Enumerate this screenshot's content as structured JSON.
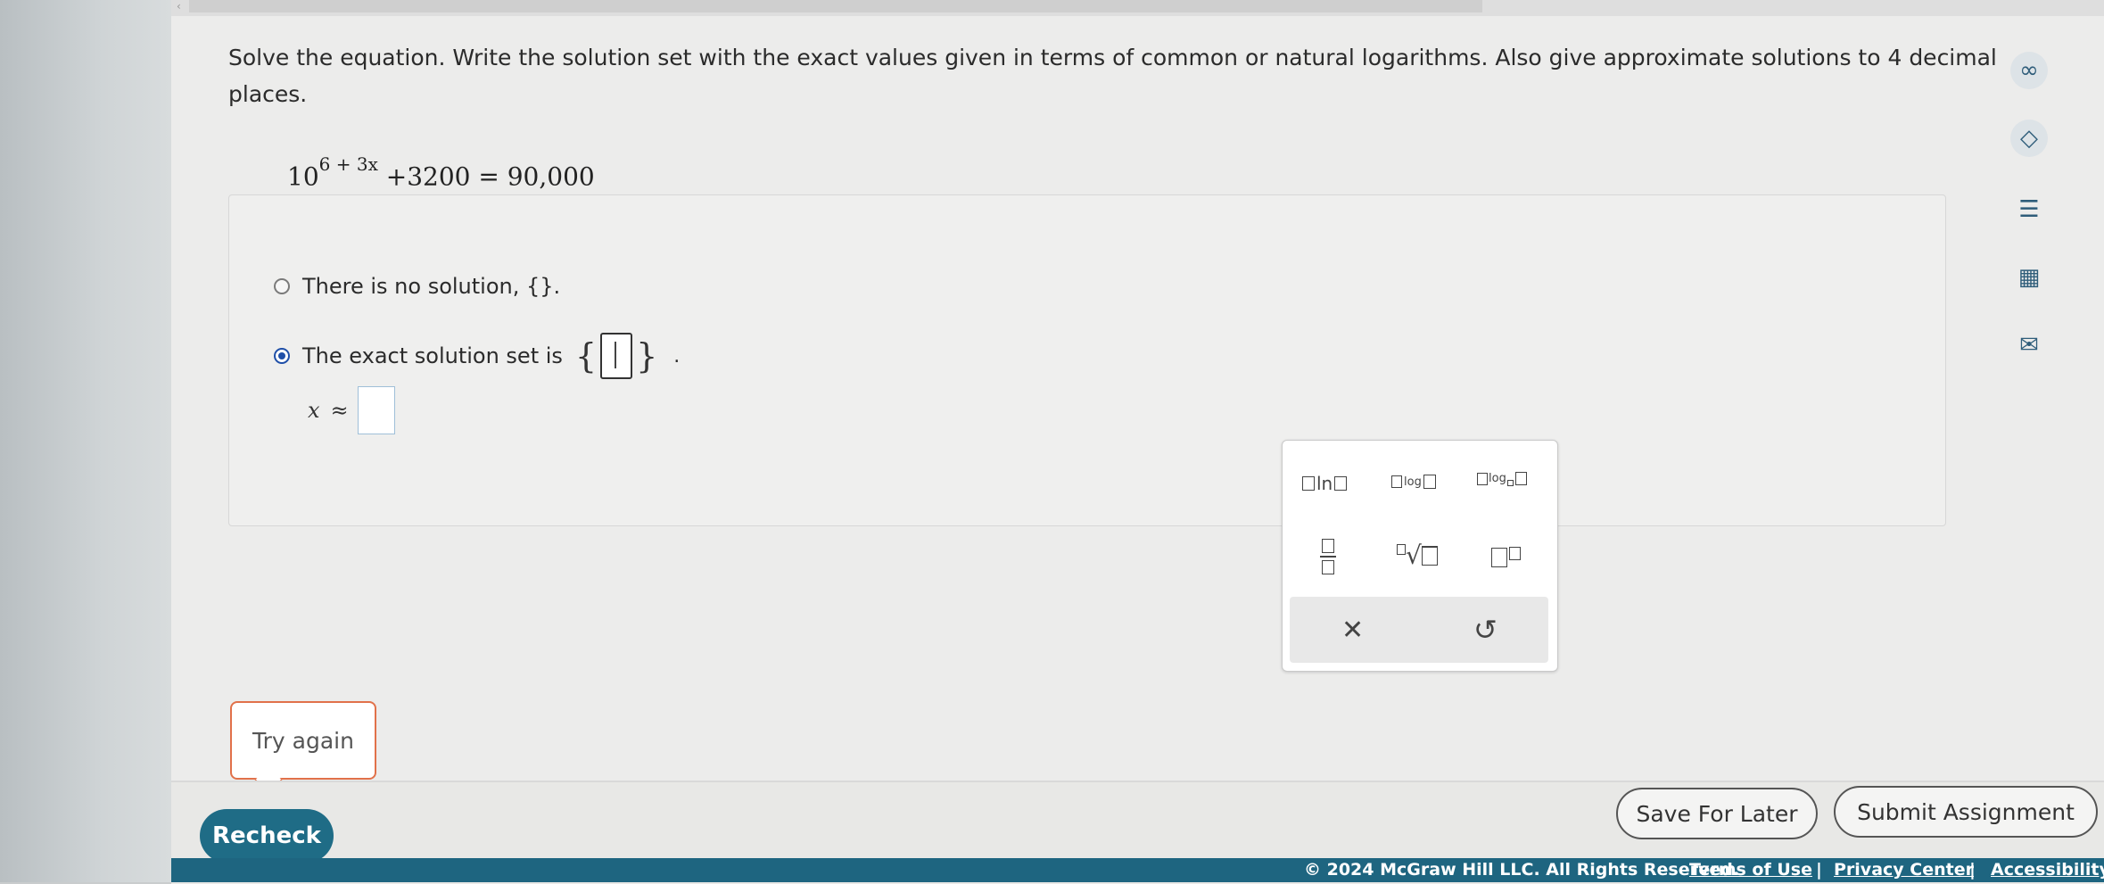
{
  "question": {
    "prompt": "Solve the equation. Write the solution set with the exact values given in terms of common or natural logarithms. Also give approximate solutions to 4 decimal places.",
    "equation_base": "10",
    "equation_exponent": "6 + 3x",
    "equation_rest": "+3200 = 90,000"
  },
  "options": {
    "no_solution": "There is no solution, {}.",
    "exact_set": "The exact solution set is",
    "selected": "exact_set"
  },
  "approx": {
    "var": "x",
    "symbol": "≈"
  },
  "palette": {
    "ln": "ln",
    "log": "log",
    "logb": "log",
    "selected_colors": {
      "accent": "#1f4fa8"
    }
  },
  "feedback": {
    "message": "Try again"
  },
  "buttons": {
    "recheck": "Recheck",
    "save": "Save For Later",
    "submit": "Submit Assignment"
  },
  "footer": {
    "copyright": "© 2024 McGraw Hill LLC. All Rights Reserved.",
    "terms": "Terms of Use",
    "sep": "|",
    "privacy": "Privacy Center",
    "accessibility": "Accessibility"
  },
  "colors": {
    "primary": "#1f6c86",
    "feedback_border": "#e1714a",
    "footer_bg": "#1e6580"
  }
}
